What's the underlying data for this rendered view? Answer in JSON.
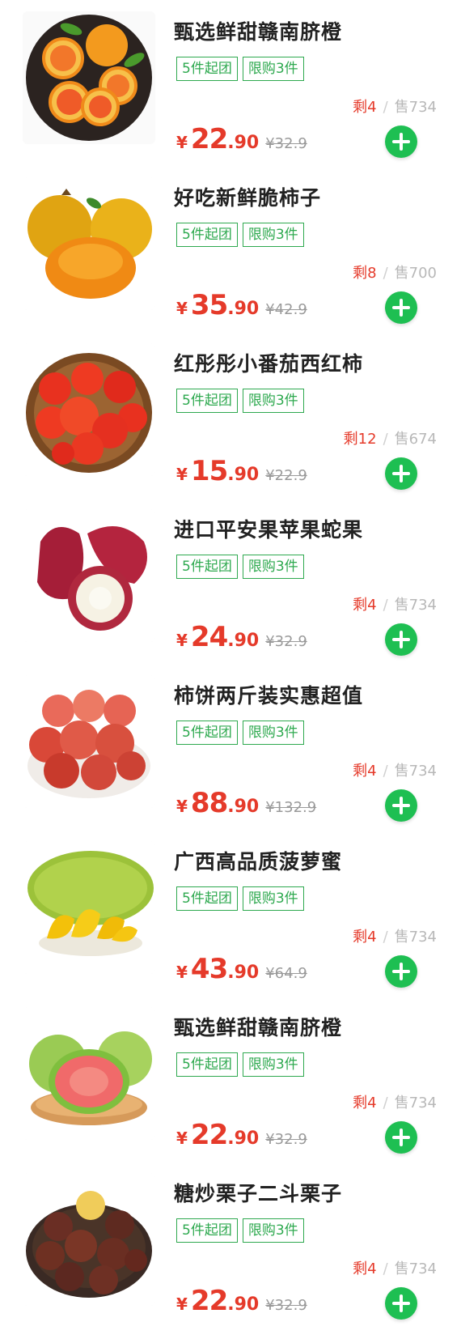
{
  "products": [
    {
      "title": "甄选鲜甜赣南脐橙",
      "tags": [
        "5件起团",
        "限购3件"
      ],
      "stock_left": "剩4",
      "slash": "/",
      "sold": "售734",
      "currency": "¥",
      "price_int": "22",
      "price_dec": ".90",
      "orig_price": "¥32.9",
      "image_icon": "navel-orange-image"
    },
    {
      "title": "好吃新鲜脆柿子",
      "tags": [
        "5件起团",
        "限购3件"
      ],
      "stock_left": "剩8",
      "slash": "/",
      "sold": "售700",
      "currency": "¥",
      "price_int": "35",
      "price_dec": ".90",
      "orig_price": "¥42.9",
      "image_icon": "persimmon-image"
    },
    {
      "title": "红彤彤小番茄西红柿",
      "tags": [
        "5件起团",
        "限购3件"
      ],
      "stock_left": "剩12",
      "slash": "/",
      "sold": "售674",
      "currency": "¥",
      "price_int": "15",
      "price_dec": ".90",
      "orig_price": "¥22.9",
      "image_icon": "tomato-basket-image"
    },
    {
      "title": "进口平安果苹果蛇果",
      "tags": [
        "5件起团",
        "限购3件"
      ],
      "stock_left": "剩4",
      "slash": "/",
      "sold": "售734",
      "currency": "¥",
      "price_int": "24",
      "price_dec": ".90",
      "orig_price": "¥32.9",
      "image_icon": "wax-apple-image"
    },
    {
      "title": "柿饼两斤装实惠超值",
      "tags": [
        "5件起团",
        "限购3件"
      ],
      "stock_left": "剩4",
      "slash": "/",
      "sold": "售734",
      "currency": "¥",
      "price_int": "88",
      "price_dec": ".90",
      "orig_price": "¥132.9",
      "image_icon": "dried-persimmon-image"
    },
    {
      "title": "广西高品质菠萝蜜",
      "tags": [
        "5件起团",
        "限购3件"
      ],
      "stock_left": "剩4",
      "slash": "/",
      "sold": "售734",
      "currency": "¥",
      "price_int": "43",
      "price_dec": ".90",
      "orig_price": "¥64.9",
      "image_icon": "jackfruit-image"
    },
    {
      "title": "甄选鲜甜赣南脐橙",
      "tags": [
        "5件起团",
        "限购3件"
      ],
      "stock_left": "剩4",
      "slash": "/",
      "sold": "售734",
      "currency": "¥",
      "price_int": "22",
      "price_dec": ".90",
      "orig_price": "¥32.9",
      "image_icon": "guava-image"
    },
    {
      "title": "糖炒栗子二斗栗子",
      "tags": [
        "5件起团",
        "限购3件"
      ],
      "stock_left": "剩4",
      "slash": "/",
      "sold": "售734",
      "currency": "¥",
      "price_int": "22",
      "price_dec": ".90",
      "orig_price": "¥32.9",
      "image_icon": "chestnut-image"
    }
  ],
  "colors": {
    "accent_green": "#1ebf52",
    "price_red": "#e53a2a",
    "tag_green": "#2ea94f"
  }
}
